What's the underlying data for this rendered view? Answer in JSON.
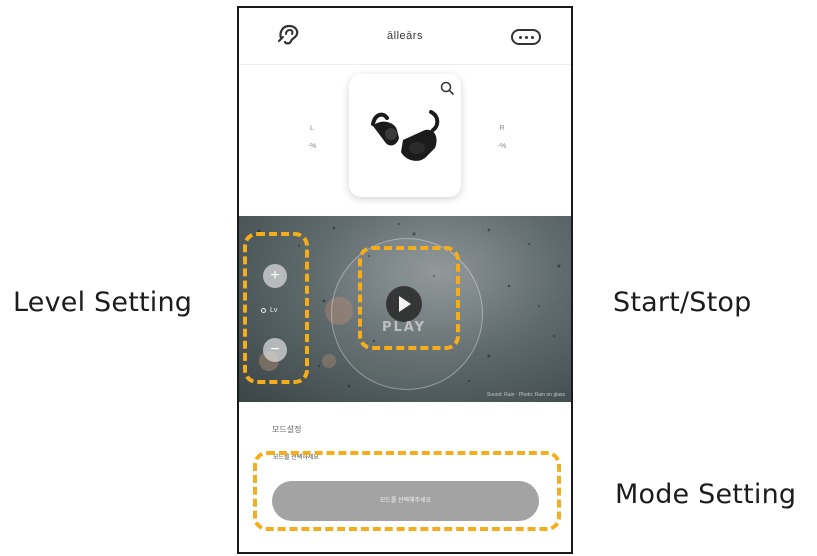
{
  "annotations": {
    "level": "Level Setting",
    "start_stop": "Start/Stop",
    "mode": "Mode Setting"
  },
  "app": {
    "title": "ālleārs",
    "icons": {
      "logo": "ear-logo-icon",
      "menu": "more-options-icon"
    }
  },
  "device": {
    "left": {
      "label": "L",
      "value": "-%"
    },
    "right": {
      "label": "R",
      "value": "-%"
    },
    "icons": {
      "search": "search-icon",
      "image": "earbuds-image"
    }
  },
  "player": {
    "plus": "+",
    "minus": "−",
    "level_label": "Lv",
    "play_text": "PLAY",
    "credit": "Sound: Rain · Photo: Rain on glass"
  },
  "mode": {
    "title": "모드설정",
    "caption": "모드를 선택하세요",
    "select_placeholder": "모드를 선택해주세요"
  },
  "colors": {
    "highlight": "#f5ad1b",
    "select_bg": "#a3a3a3",
    "player_bg": "#5f6a6c"
  }
}
